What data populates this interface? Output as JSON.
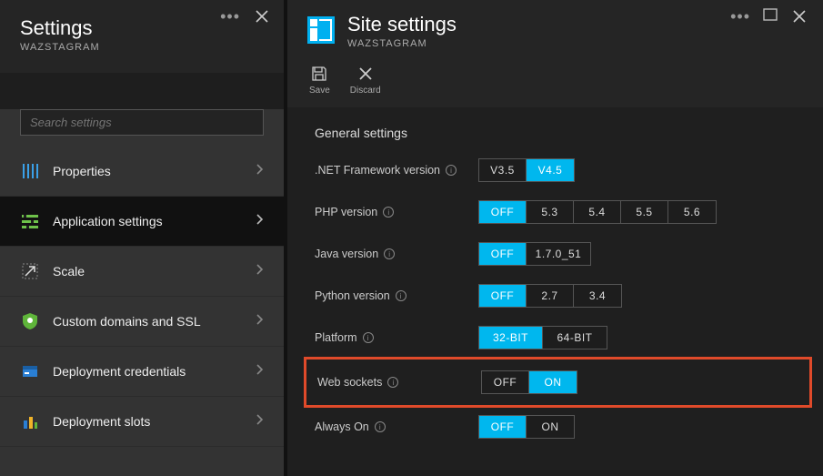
{
  "left": {
    "title": "Settings",
    "subtitle": "WAZSTAGRAM",
    "search_placeholder": "Search settings",
    "nav": [
      {
        "label": "Properties"
      },
      {
        "label": "Application settings"
      },
      {
        "label": "Scale"
      },
      {
        "label": "Custom domains and SSL"
      },
      {
        "label": "Deployment credentials"
      },
      {
        "label": "Deployment slots"
      }
    ]
  },
  "right": {
    "title": "Site settings",
    "subtitle": "WAZSTAGRAM",
    "toolbar": {
      "save": "Save",
      "discard": "Discard"
    },
    "section": "General settings",
    "rows": {
      "netfx": {
        "label": ".NET Framework version",
        "options": [
          "V3.5",
          "V4.5"
        ],
        "active": "V4.5"
      },
      "php": {
        "label": "PHP version",
        "options": [
          "OFF",
          "5.3",
          "5.4",
          "5.5",
          "5.6"
        ],
        "active": "OFF"
      },
      "java": {
        "label": "Java version",
        "options": [
          "OFF",
          "1.7.0_51"
        ],
        "active": "OFF"
      },
      "python": {
        "label": "Python version",
        "options": [
          "OFF",
          "2.7",
          "3.4"
        ],
        "active": "OFF"
      },
      "platform": {
        "label": "Platform",
        "options": [
          "32-BIT",
          "64-BIT"
        ],
        "active": "32-BIT"
      },
      "ws": {
        "label": "Web sockets",
        "options": [
          "OFF",
          "ON"
        ],
        "active": "ON"
      },
      "always": {
        "label": "Always On",
        "options": [
          "OFF",
          "ON"
        ],
        "active": "OFF"
      }
    }
  }
}
